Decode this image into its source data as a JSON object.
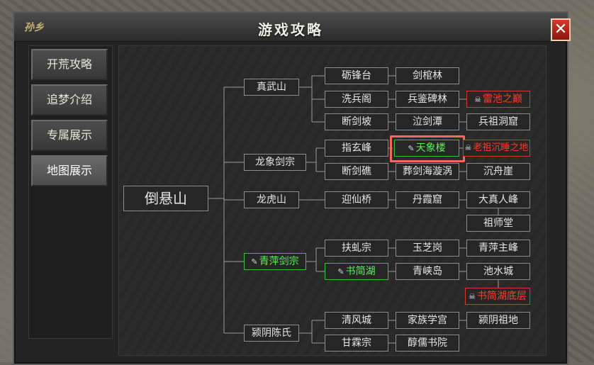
{
  "window": {
    "title": "游戏攻略",
    "logo_text": "孙乡",
    "close_label": "✕"
  },
  "sidebar": {
    "items": [
      {
        "label": "开荒攻略",
        "active": false
      },
      {
        "label": "追梦介绍",
        "active": false
      },
      {
        "label": "专属展示",
        "active": false
      },
      {
        "label": "地图展示",
        "active": true
      }
    ]
  },
  "map": {
    "root": "倒悬山",
    "regions": [
      {
        "label": "真武山"
      },
      {
        "label": "龙象剑宗"
      },
      {
        "label": "龙虎山"
      },
      {
        "label": "青萍剑宗",
        "style": "green",
        "icon": "scroll-icon"
      },
      {
        "label": "颍阴陈氏"
      }
    ],
    "places": [
      {
        "label": "砺锋台"
      },
      {
        "label": "洗兵阁"
      },
      {
        "label": "断剑坡"
      },
      {
        "label": "指玄峰"
      },
      {
        "label": "断剑礁"
      },
      {
        "label": "迎仙桥"
      },
      {
        "label": "扶虬宗"
      },
      {
        "label": "书简湖",
        "style": "green",
        "icon": "scroll-icon"
      },
      {
        "label": "清风城"
      },
      {
        "label": "甘霖宗"
      }
    ],
    "subplaces": [
      {
        "label": "剑棺林"
      },
      {
        "label": "兵鉴碑林"
      },
      {
        "label": "泣剑潭"
      },
      {
        "label": "天象楼",
        "style": "green",
        "icon": "scroll-icon",
        "highlighted": true
      },
      {
        "label": "葬剑海漩涡"
      },
      {
        "label": "丹霞窟"
      },
      {
        "label": "玉芝岗"
      },
      {
        "label": "青峡岛"
      },
      {
        "label": "家族学宫"
      },
      {
        "label": "醇儒书院"
      }
    ],
    "endpoints": [
      {
        "label": "雷池之巅",
        "style": "red",
        "icon": "skull-icon"
      },
      {
        "label": "兵祖洞窟"
      },
      {
        "label": "老祖沉睡之地",
        "style": "red",
        "icon": "skull-icon"
      },
      {
        "label": "沉舟崖"
      },
      {
        "label": "大真人峰"
      },
      {
        "label": "祖师堂"
      },
      {
        "label": "青萍主峰"
      },
      {
        "label": "池水城"
      },
      {
        "label": "书简湖底层",
        "style": "red",
        "icon": "skull-icon"
      },
      {
        "label": "颍阴祖地"
      }
    ]
  },
  "colors": {
    "green_border": "#35c13d",
    "red_text": "#ff3a2b",
    "highlight": "#f26a5e"
  }
}
